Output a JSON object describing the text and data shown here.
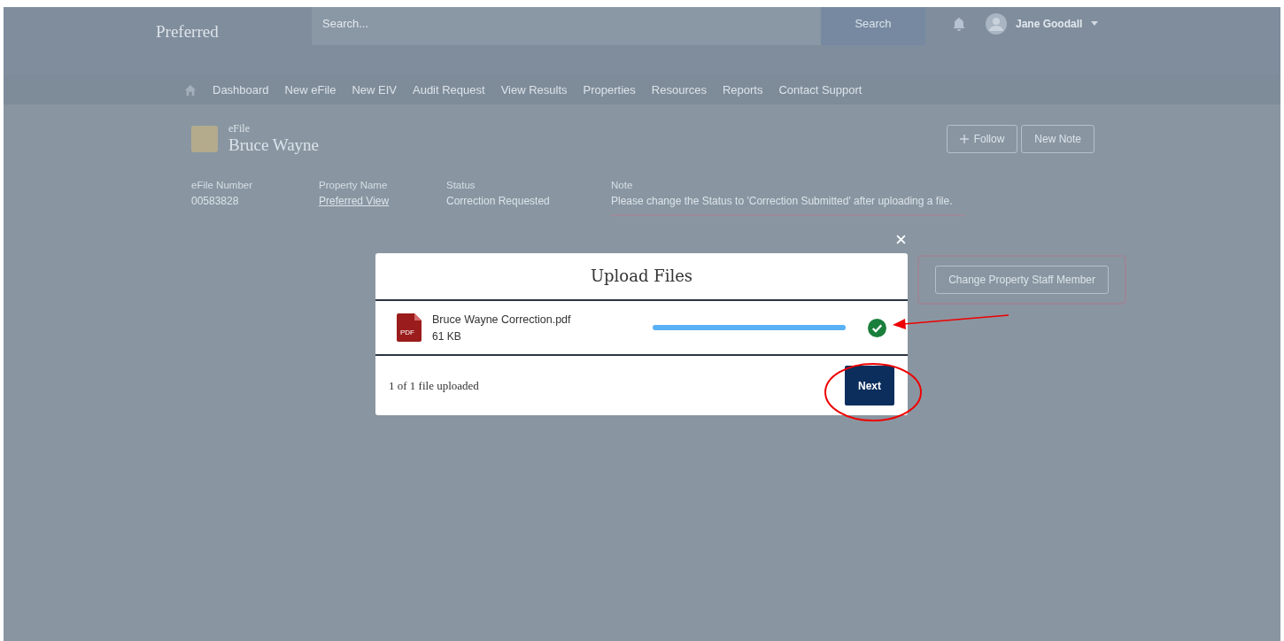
{
  "header": {
    "logo": "Preferred",
    "search": {
      "placeholder": "Search...",
      "button": "Search"
    },
    "user": "Jane Goodall"
  },
  "nav": [
    "Dashboard",
    "New eFile",
    "New EIV",
    "Audit Request",
    "View Results",
    "Properties",
    "Resources",
    "Reports",
    "Contact Support"
  ],
  "record": {
    "type": "eFile",
    "title": "Bruce Wayne",
    "actions": [
      "Follow",
      "New Note"
    ],
    "fields": [
      {
        "label": "eFile Number",
        "value": "00583828",
        "kind": "text"
      },
      {
        "label": "Property Name",
        "value": "Preferred View",
        "kind": "link"
      },
      {
        "label": "Status",
        "value": "Correction Requested",
        "kind": "text"
      },
      {
        "label": "Note",
        "value": "Please change the Status to 'Correction Submitted' after uploading a file.",
        "kind": "note"
      }
    ],
    "secondary_button": "Change Property Staff Member"
  },
  "modal": {
    "title": "Upload Files",
    "files": [
      {
        "name": "Bruce Wayne Correction.pdf",
        "size": "61 KB",
        "icon": "PDF",
        "level": 1,
        "complete": true
      }
    ],
    "summary": "1 of 1 file uploaded",
    "button": "Next"
  }
}
